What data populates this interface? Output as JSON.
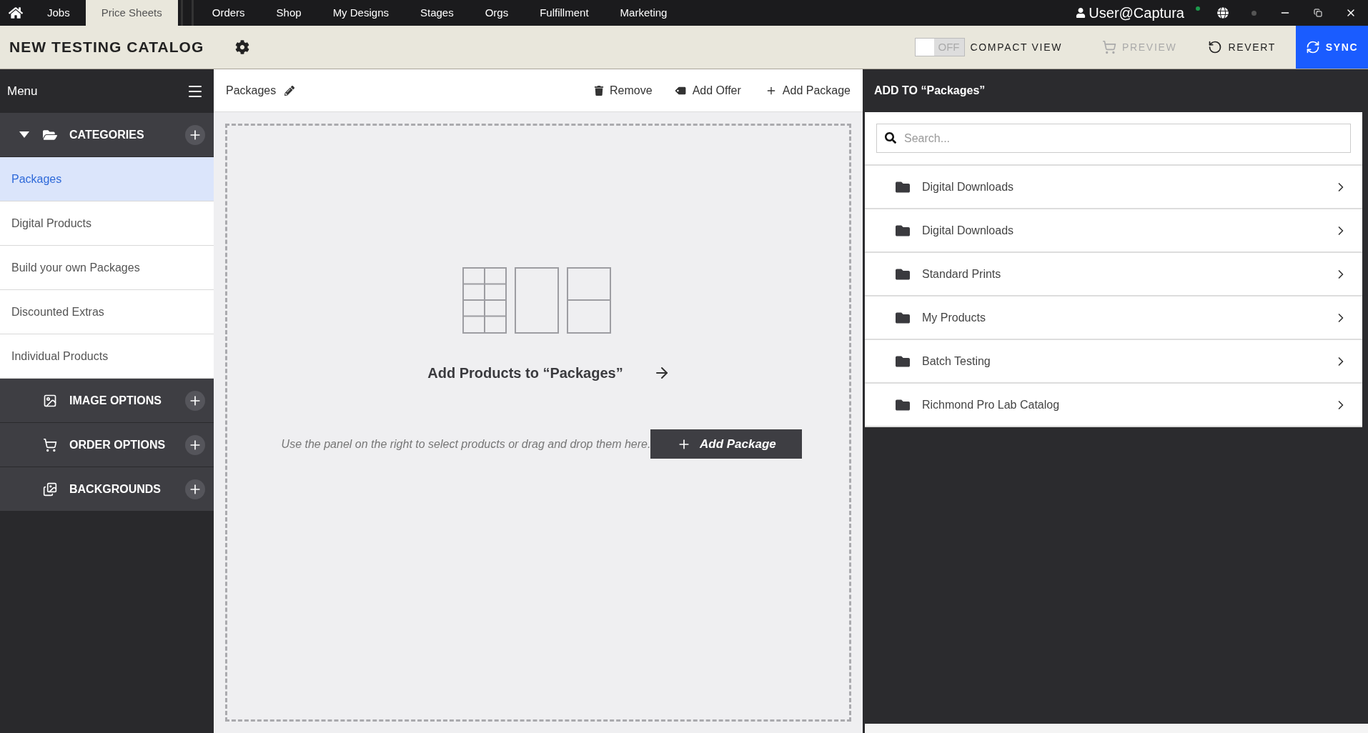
{
  "nav": {
    "tabs": [
      {
        "label": "Jobs",
        "selected": false
      },
      {
        "label": "Price Sheets",
        "selected": true
      },
      {
        "label": "Orders",
        "selected": false
      },
      {
        "label": "Shop",
        "selected": false
      },
      {
        "label": "My Designs",
        "selected": false
      },
      {
        "label": "Stages",
        "selected": false
      },
      {
        "label": "Orgs",
        "selected": false
      },
      {
        "label": "Fulfillment",
        "selected": false
      },
      {
        "label": "Marketing",
        "selected": false
      }
    ],
    "user": "User@Captura"
  },
  "header": {
    "title": "NEW TESTING CATALOG",
    "compact_view": {
      "toggle_text": "OFF",
      "label": "COMPACT VIEW",
      "on": false
    },
    "actions": [
      {
        "kind": "preview",
        "label": "PREVIEW",
        "disabled": true
      },
      {
        "kind": "revert",
        "label": "REVERT",
        "disabled": false
      },
      {
        "kind": "sync",
        "label": "SYNC",
        "disabled": false
      }
    ]
  },
  "sidebar": {
    "title": "Menu",
    "sections": [
      {
        "kind": "categories",
        "label": "CATEGORIES",
        "expanded": true,
        "children": [
          {
            "label": "Packages",
            "selected": true
          },
          {
            "label": "Digital Products",
            "selected": false
          },
          {
            "label": "Build your own Packages",
            "selected": false
          },
          {
            "label": "Discounted Extras",
            "selected": false
          },
          {
            "label": "Individual Products",
            "selected": false
          }
        ]
      },
      {
        "kind": "image",
        "label": "IMAGE OPTIONS",
        "expanded": false
      },
      {
        "kind": "order",
        "label": "ORDER OPTIONS",
        "expanded": false
      },
      {
        "kind": "backgrounds",
        "label": "BACKGROUNDS",
        "expanded": false
      }
    ]
  },
  "toolbar": {
    "title": "Packages",
    "actions": [
      {
        "kind": "remove",
        "label": "Remove"
      },
      {
        "kind": "offer",
        "label": "Add Offer"
      },
      {
        "kind": "add",
        "label": "Add Package"
      }
    ]
  },
  "dropzone": {
    "heading": "Add Products to “Packages”",
    "hint": "Use the panel on the right to select products or drag and drop them here.",
    "button": "Add Package"
  },
  "panel": {
    "title": "ADD TO “Packages”",
    "search": {
      "placeholder": "Search..."
    },
    "items": [
      "Digital Downloads",
      "Digital Downloads",
      "Standard Prints",
      "My Products",
      "Batch Testing",
      "Richmond Pro Lab Catalog"
    ]
  }
}
